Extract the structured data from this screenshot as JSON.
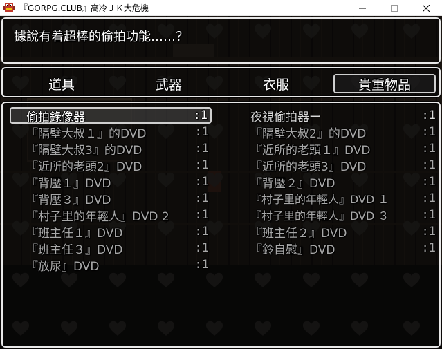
{
  "window": {
    "title": "『GORPG.CLUB』高冷ＪＫ大危機",
    "app_icon": "red-pixel-icon",
    "minimize_icon": "minimize-icon",
    "maximize_icon": "maximize-icon",
    "close_icon": "close-icon"
  },
  "help": {
    "text": "據說有着超棒的偷拍功能……？"
  },
  "categories": [
    {
      "label": "道具",
      "selected": false
    },
    {
      "label": "武器",
      "selected": false
    },
    {
      "label": "衣服",
      "selected": false
    },
    {
      "label": "貴重物品",
      "selected": true
    }
  ],
  "items_left": [
    {
      "name": "偷拍錄像器",
      "count": ":1"
    },
    {
      "name": "『隔壁大叔１』的DVD",
      "count": ":1"
    },
    {
      "name": "『隔壁大叔3』的DVD",
      "count": ":1"
    },
    {
      "name": "『近所的老頭2』DVD",
      "count": ":1"
    },
    {
      "name": "『背壓１』DVD",
      "count": ":1"
    },
    {
      "name": "『背壓３』DVD",
      "count": ":1"
    },
    {
      "name": "『村子里的年輕人』DVD 2",
      "count": ":1"
    },
    {
      "name": "『班主任１』DVD",
      "count": ":1"
    },
    {
      "name": "『班主任３』DVD",
      "count": ":1"
    },
    {
      "name": "『放尿』DVD",
      "count": ":1"
    }
  ],
  "items_right": [
    {
      "name": "夜視偷拍器ー",
      "count": ":1"
    },
    {
      "name": "『隔壁大叔2』的DVD",
      "count": ":1"
    },
    {
      "name": "『近所的老頭１』DVD",
      "count": ":1"
    },
    {
      "name": "『近所的老頭3』DVD",
      "count": ":1"
    },
    {
      "name": "『背壓２』DVD",
      "count": ":1"
    },
    {
      "name": "『村子里的年輕人』DVD １",
      "count": ":1"
    },
    {
      "name": "『村子里的年輕人』DVD ３",
      "count": ":1"
    },
    {
      "name": "『班主任２』DVD",
      "count": ":1"
    },
    {
      "name": "『鈴自慰』DVD",
      "count": ":1"
    }
  ],
  "colors": {
    "window_border": "#e8e8e8",
    "text": "#ffffff",
    "dim_text": "#a8a8a8",
    "background": "#0d0b0a"
  },
  "decor": {
    "pattern_icon": "heart-icon"
  }
}
